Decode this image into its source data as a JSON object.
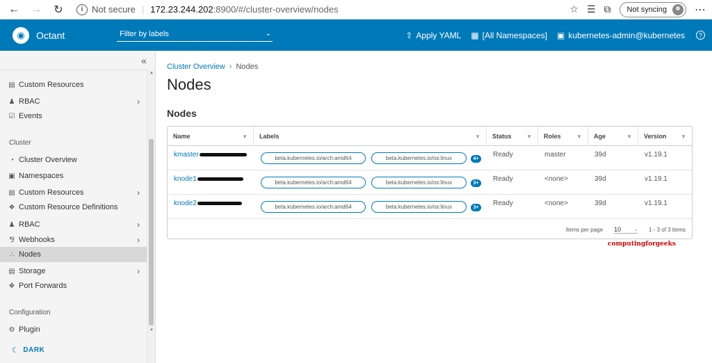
{
  "browser": {
    "back_icon": "back-arrow-icon",
    "forward_icon": "forward-arrow-icon",
    "reload_icon": "reload-icon",
    "security_text": "Not secure",
    "url_host": "172.23.244.202",
    "url_rest": ":8900/#/cluster-overview/nodes",
    "sync_label": "Not syncing"
  },
  "header": {
    "brand": "Octant",
    "filter_placeholder": "Filter by labels",
    "apply_yaml": "Apply YAML",
    "namespaces": "[All Namespaces]",
    "context": "kubernetes-admin@kubernetes",
    "accent_color": "#0079b8"
  },
  "sidebar": {
    "items_top": [
      {
        "label": "Custom Resources",
        "icon": "stack-icon"
      },
      {
        "label": "RBAC",
        "icon": "user-icon"
      },
      {
        "label": "Events",
        "icon": "calendar-check-icon"
      }
    ],
    "cluster_section": "Cluster",
    "cluster_items": [
      {
        "label": "Cluster Overview",
        "icon": "dashboard-icon"
      },
      {
        "label": "Namespaces",
        "icon": "layers-icon"
      },
      {
        "label": "Custom Resources",
        "icon": "stack-icon"
      },
      {
        "label": "Custom Resource Definitions",
        "icon": "cubes-icon"
      },
      {
        "label": "RBAC",
        "icon": "user-icon"
      },
      {
        "label": "Webhooks",
        "icon": "webhook-icon"
      },
      {
        "label": "Nodes",
        "icon": "nodes-icon"
      },
      {
        "label": "Storage",
        "icon": "storage-icon"
      },
      {
        "label": "Port Forwards",
        "icon": "move-icon"
      }
    ],
    "config_section": "Configuration",
    "config_items": [
      {
        "label": "Plugin",
        "icon": "plugin-icon"
      }
    ],
    "dark_label": "DARK"
  },
  "main": {
    "breadcrumb_parent": "Cluster Overview",
    "breadcrumb_current": "Nodes",
    "page_title": "Nodes",
    "section_title": "Nodes",
    "columns": [
      "Name",
      "Labels",
      "Status",
      "Roles",
      "Age",
      "Version"
    ],
    "rows": [
      {
        "name": "kmaster",
        "label1": "beta.kubernetes.io/arch:amd64",
        "label2": "beta.kubernetes.io/os:linux",
        "more": "4+",
        "status": "Ready",
        "roles": "master",
        "age": "39d",
        "version": "v1.19.1"
      },
      {
        "name": "knode1",
        "label1": "beta.kubernetes.io/arch:amd64",
        "label2": "beta.kubernetes.io/os:linux",
        "more": "3+",
        "status": "Ready",
        "roles": "<none>",
        "age": "39d",
        "version": "v1.19.1"
      },
      {
        "name": "knode2",
        "label1": "beta.kubernetes.io/arch:amd64",
        "label2": "beta.kubernetes.io/os:linux",
        "more": "3+",
        "status": "Ready",
        "roles": "<none>",
        "age": "39d",
        "version": "v1.19.1"
      }
    ],
    "footer": {
      "per_page_label": "Items per page",
      "per_page_value": "10",
      "range": "1 - 3 of 3 items"
    },
    "watermark": "computingforgeeks"
  }
}
